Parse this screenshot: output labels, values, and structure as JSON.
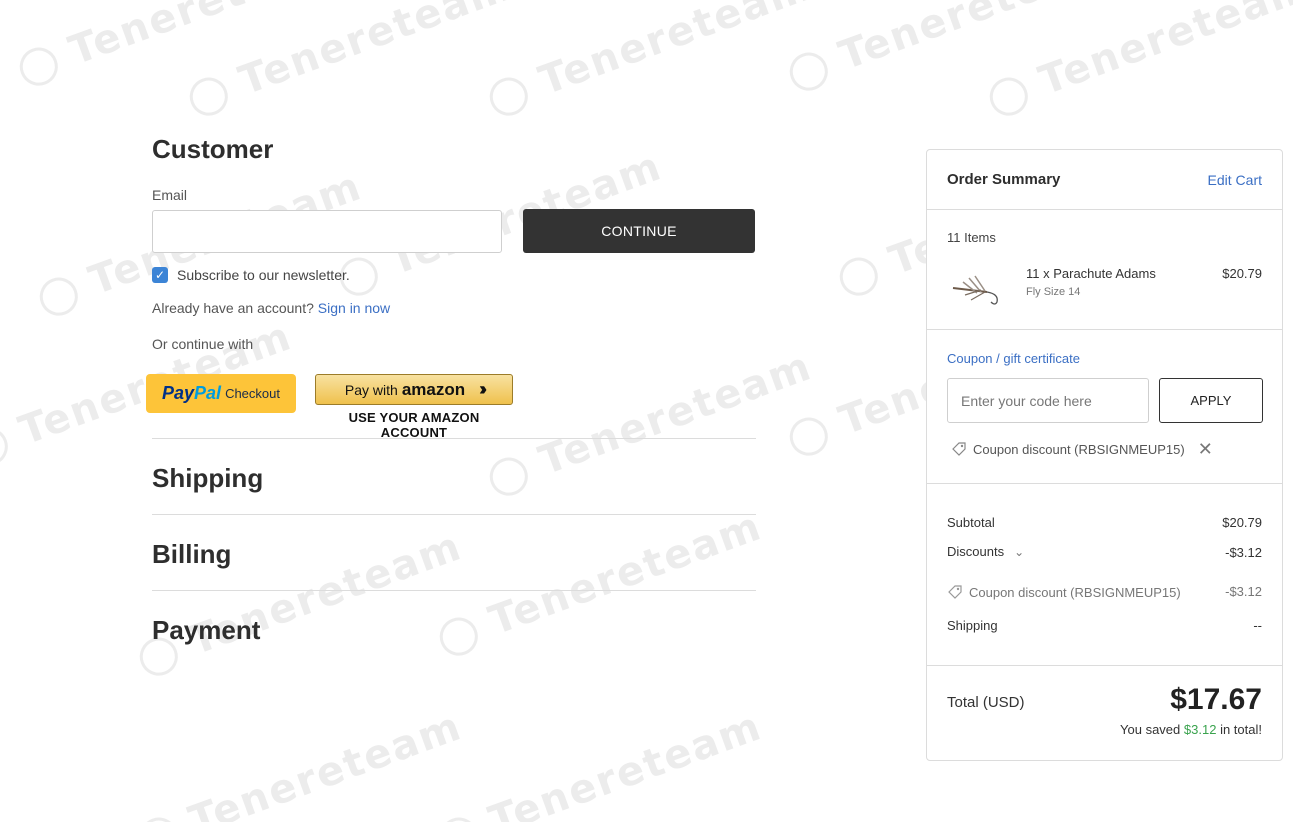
{
  "watermark": {
    "text": "Tenereteam"
  },
  "customer": {
    "title": "Customer",
    "email_label": "Email",
    "email_value": "",
    "continue_label": "CONTINUE",
    "subscribe_label": "Subscribe to our newsletter.",
    "subscribe_checked": true,
    "account_prompt": "Already have an account?",
    "sign_in_label": "Sign in now",
    "or_continue": "Or continue with",
    "paypal": {
      "pay": "Pay",
      "pal": "Pal",
      "checkout": "Checkout"
    },
    "amazon": {
      "pay_with": "Pay with",
      "brand": "amazon",
      "subtext": "USE YOUR AMAZON ACCOUNT"
    }
  },
  "sections": [
    {
      "title": "Shipping"
    },
    {
      "title": "Billing"
    },
    {
      "title": "Payment"
    }
  ],
  "order_summary": {
    "title": "Order Summary",
    "edit_cart": "Edit Cart",
    "item_count": "11 Items",
    "items": [
      {
        "name": "11 x Parachute Adams",
        "variant": "Fly Size 14",
        "price": "$20.79",
        "image": "fly-lure-image"
      }
    ],
    "coupon": {
      "link": "Coupon / gift certificate",
      "placeholder": "Enter your code here",
      "apply_label": "APPLY",
      "applied_label": "Coupon discount (RBSIGNMEUP15)"
    },
    "subtotal": {
      "label": "Subtotal",
      "value": "$20.79"
    },
    "discounts": {
      "label": "Discounts",
      "value": "-$3.12",
      "detail_label": "Coupon discount (RBSIGNMEUP15)",
      "detail_value": "-$3.12"
    },
    "shipping": {
      "label": "Shipping",
      "value": "--"
    },
    "total": {
      "label": "Total (USD)",
      "value": "$17.67",
      "saved_prefix": "You saved",
      "saved_amount": "$3.12",
      "saved_suffix": "in total!"
    }
  },
  "colors": {
    "link": "#3b6fc4",
    "dark_button": "#333333",
    "saved_green": "#3aa34e",
    "paypal_yellow": "#fdc439"
  }
}
